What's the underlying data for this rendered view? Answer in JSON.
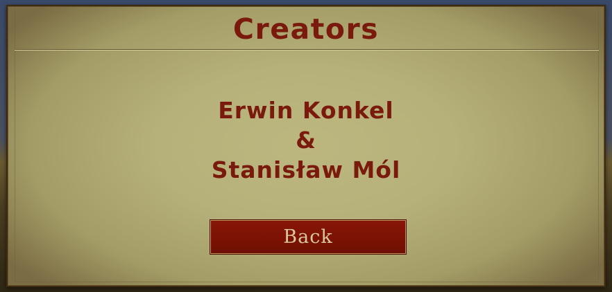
{
  "dialog": {
    "title": "Creators",
    "credits": [
      "Erwin Konkel",
      "&",
      "Stanisław Mól"
    ],
    "back_label": "Back"
  },
  "colors": {
    "title_text": "#7a1a0c",
    "panel_parchment": "#b6b07a",
    "button_fill": "#7a1204",
    "button_text": "#d8c8a0"
  }
}
